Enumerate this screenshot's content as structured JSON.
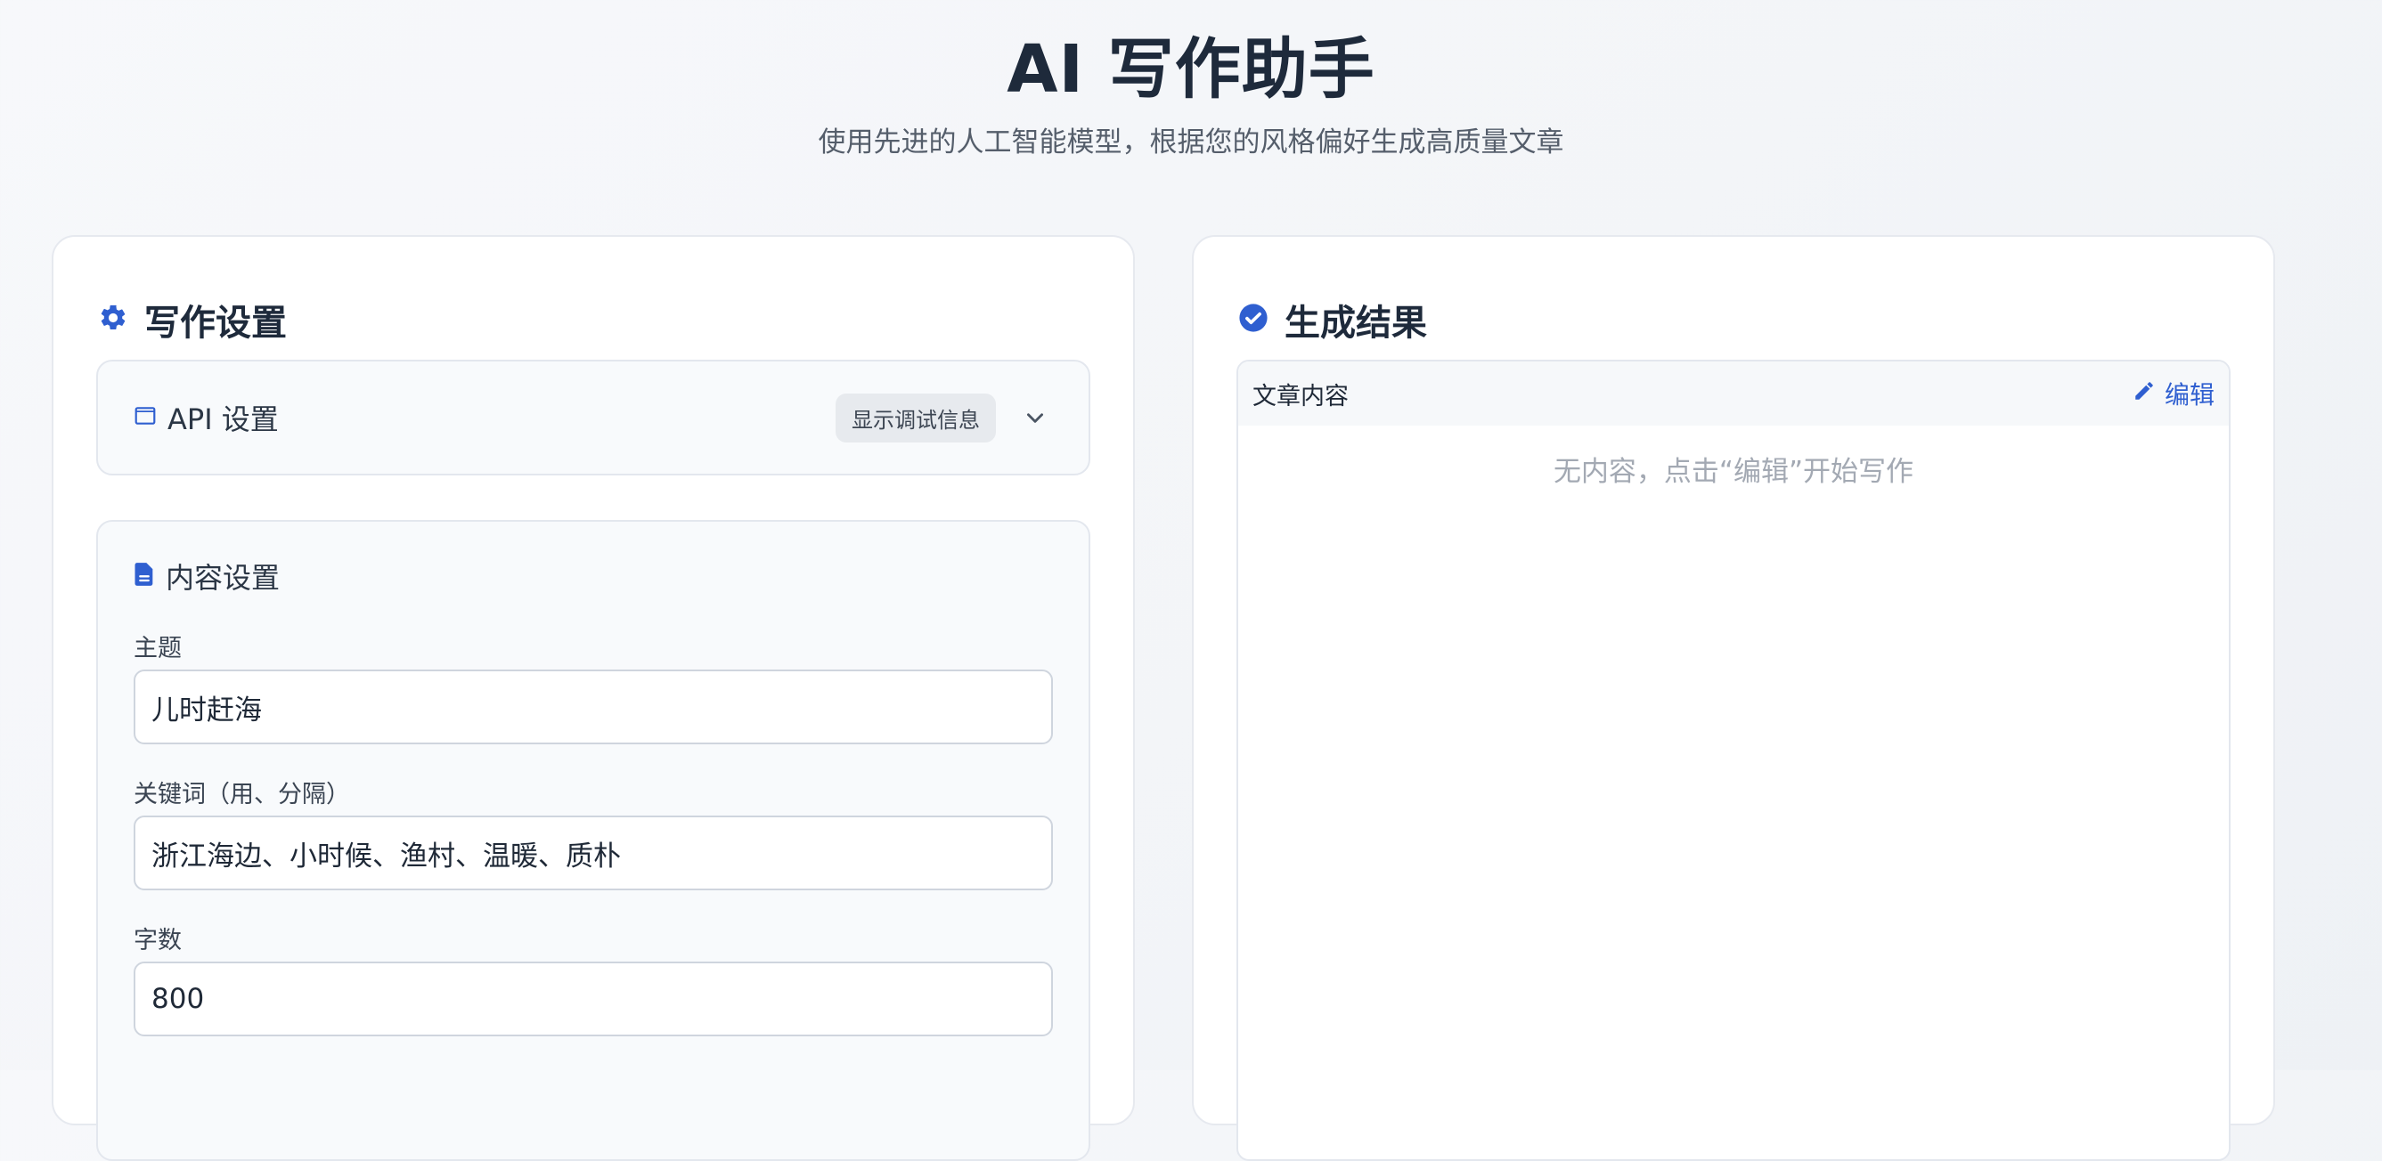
{
  "header": {
    "title": "AI 写作助手",
    "subtitle": "使用先进的人工智能模型，根据您的风格偏好生成高质量文章"
  },
  "settings": {
    "title": "写作设置",
    "api": {
      "label": "API 设置",
      "debug_button": "显示调试信息"
    },
    "content": {
      "title": "内容设置",
      "topic_label": "主题",
      "topic_value": "儿时赶海",
      "keywords_label": "关键词（用、分隔）",
      "keywords_value": "浙江海边、小时候、渔村、温暖、质朴",
      "words_label": "字数",
      "words_value": "800"
    }
  },
  "result": {
    "title": "生成结果",
    "article_label": "文章内容",
    "edit_label": "编辑",
    "empty_text": "无内容，点击“编辑”开始写作"
  },
  "icons": {
    "settings": "gear-icon",
    "api": "window-icon",
    "debug_toggle": "chevron-down-icon",
    "content": "document-icon",
    "result": "check-circle-icon",
    "edit": "pencil-icon"
  },
  "colors": {
    "accent": "#2f5fd0",
    "title": "#1e2a3b",
    "muted": "#a3a9b3"
  }
}
